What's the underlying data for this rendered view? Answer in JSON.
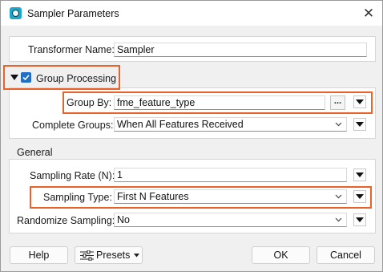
{
  "window": {
    "title": "Sampler Parameters",
    "close_glyph": "✕",
    "icon": "fme-app-icon"
  },
  "transformer_name": {
    "label": "Transformer Name:",
    "value": "Sampler"
  },
  "group_processing": {
    "label": "Group Processing",
    "checked": true,
    "expanded": true,
    "group_by": {
      "label": "Group By:",
      "value": "fme_feature_type",
      "ellipsis": "..."
    },
    "complete_groups": {
      "label": "Complete Groups:",
      "value": "When All Features Received"
    }
  },
  "general": {
    "title": "General",
    "sampling_rate": {
      "label": "Sampling Rate (N):",
      "value": "1"
    },
    "sampling_type": {
      "label": "Sampling Type:",
      "value": "First N Features"
    },
    "randomize_sampling": {
      "label": "Randomize Sampling:",
      "value": "No"
    }
  },
  "buttons": {
    "help": "Help",
    "presets": "Presets",
    "ok": "OK",
    "cancel": "Cancel"
  },
  "colors": {
    "highlight": "#e8622a",
    "checkbox": "#1f6fc5",
    "app_icon": "#1aa9c8"
  }
}
